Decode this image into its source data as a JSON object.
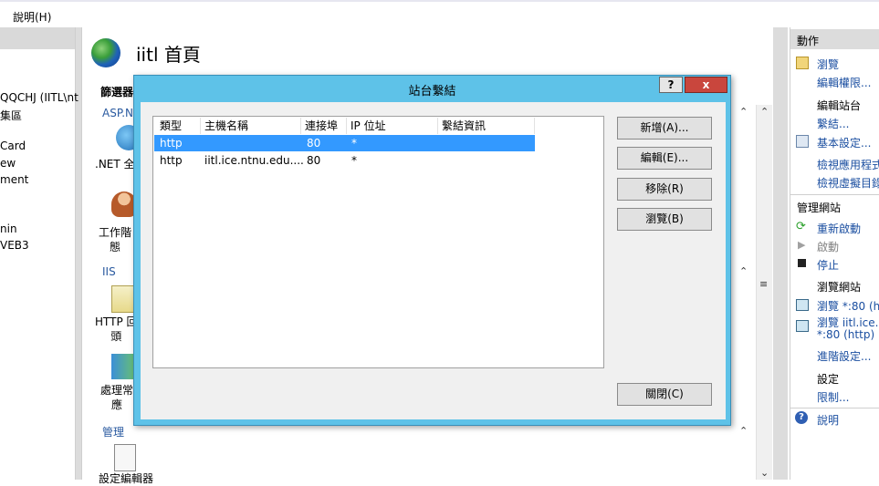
{
  "menubar": {
    "help": "說明(H)"
  },
  "left_tree": {
    "items": [
      "QQCHJ (IITL\\nt",
      "集區",
      "Card",
      "ew",
      "ment",
      "nin",
      "VEB3"
    ]
  },
  "main": {
    "title": "iitl 首頁",
    "filter_label": "篩選器",
    "sections": {
      "aspnet": "ASP.N",
      "iis": "IIS",
      "management": "管理"
    },
    "features": [
      {
        "label": ".NET 全"
      },
      {
        "label": "工作階\n態"
      },
      {
        "label": "HTTP 回\n頭"
      },
      {
        "label": "處理常\n應"
      },
      {
        "label": "設定編輯器"
      }
    ]
  },
  "dialog": {
    "title": "站台繫結",
    "help": "?",
    "close": "x",
    "columns": [
      "類型",
      "主機名稱",
      "連接埠",
      "IP 位址",
      "繫結資訊"
    ],
    "rows": [
      {
        "type": "http",
        "host": "",
        "port": "80",
        "ip": "*",
        "info": "",
        "selected": true
      },
      {
        "type": "http",
        "host": "iitl.ice.ntnu.edu....",
        "port": "80",
        "ip": "*",
        "info": "",
        "selected": false
      }
    ],
    "buttons": {
      "add": "新增(A)...",
      "edit": "編輯(E)...",
      "remove": "移除(R)",
      "browse": "瀏覽(B)",
      "close": "關閉(C)"
    }
  },
  "actions": {
    "title": "動作",
    "browse": "瀏覽",
    "edit_permissions": "編輯權限...",
    "edit_site_heading": "編輯站台",
    "bindings": "繫結...",
    "basic_settings": "基本設定...",
    "view_apps": "檢視應用程式",
    "view_vdirs": "檢視虛擬目錄",
    "manage_site_heading": "管理網站",
    "restart": "重新啟動",
    "start": "啟動",
    "stop": "停止",
    "browse_site_heading": "瀏覽網站",
    "browse_80": "瀏覽 *:80 (ht",
    "browse_iitl_1": "瀏覽 iitl.ice.n",
    "browse_iitl_2": "*:80 (http)",
    "advanced": "進階設定...",
    "settings_heading": "設定",
    "limits": "限制...",
    "help": "說明"
  },
  "colors": {
    "dialog_frame": "#5ec2e8",
    "selection": "#3399ff",
    "close_button": "#c9463d",
    "link": "#1a4ea0"
  }
}
